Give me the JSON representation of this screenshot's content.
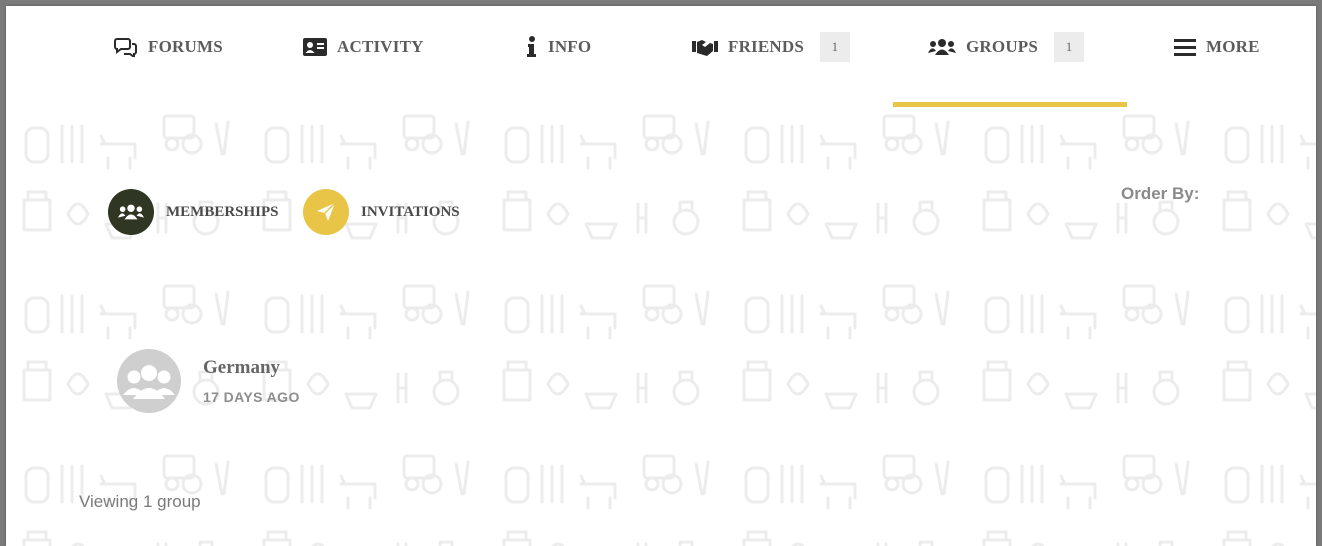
{
  "nav": {
    "items": [
      {
        "label": "FORUMS",
        "icon": "forums-icon"
      },
      {
        "label": "ACTIVITY",
        "icon": "id-card-icon"
      },
      {
        "label": "INFO",
        "icon": "info-icon"
      },
      {
        "label": "FRIENDS",
        "icon": "handshake-icon",
        "count": "1"
      },
      {
        "label": "GROUPS",
        "icon": "users-icon",
        "count": "1",
        "active": true
      },
      {
        "label": "MORE",
        "icon": "hamburger-menu-icon"
      }
    ]
  },
  "subnav": {
    "memberships_label": "MEMBERSHIPS",
    "invitations_label": "INVITATIONS",
    "order_by_label": "Order By:"
  },
  "groups": {
    "items": [
      {
        "name": "Germany",
        "time": "17 DAYS AGO"
      }
    ],
    "count_text": "Viewing 1 group"
  },
  "colors": {
    "accent": "#e8c547",
    "dark_circle": "#2f3624",
    "text": "#5c5c5c",
    "badge_bg": "#ececec"
  }
}
